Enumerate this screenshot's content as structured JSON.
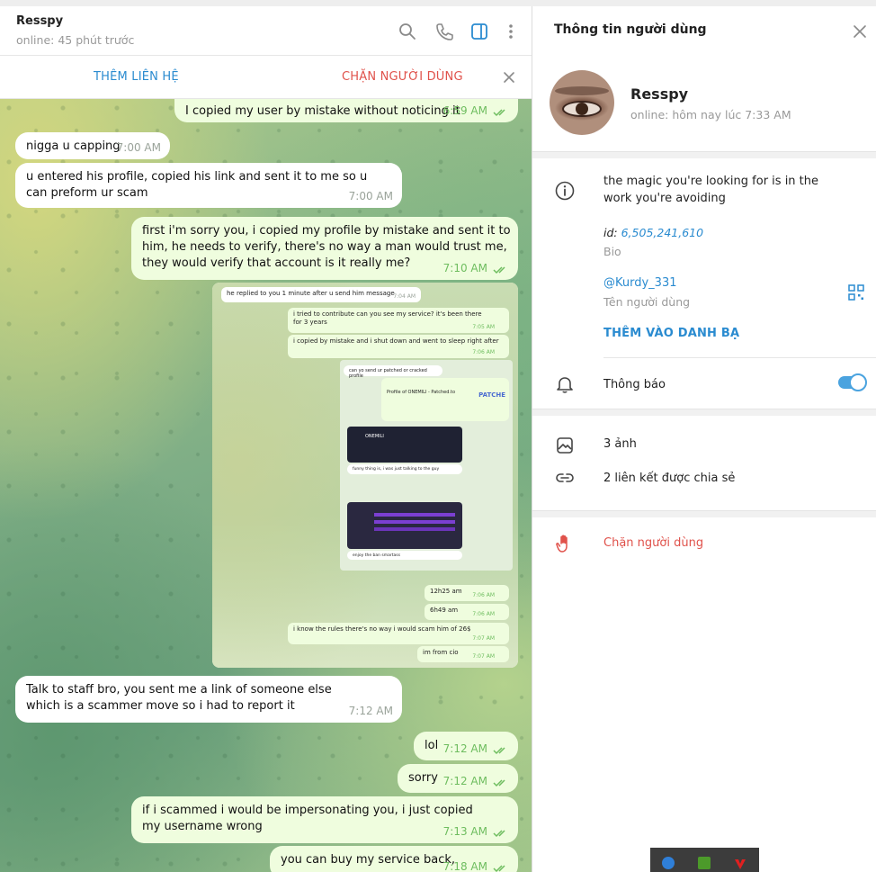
{
  "chat_header": {
    "name": "Resspy",
    "status": "online: 45 phút trước",
    "icons": [
      "search-icon",
      "phone-icon",
      "sidebar-toggle-icon",
      "more-vertical-icon"
    ]
  },
  "action_bar": {
    "add_contact": "THÊM LIÊN HỆ",
    "block_user": "CHẶN NGƯỜI DÙNG"
  },
  "messages": [
    {
      "dir": "out",
      "text": "I copied my user by mistake without noticing it",
      "time": "6:59 AM"
    },
    {
      "dir": "in",
      "text": "nigga u capping",
      "time": "7:00 AM"
    },
    {
      "dir": "in",
      "text": "u entered his profile, copied his link and sent it to me so u can preform ur scam",
      "time": "7:00 AM"
    },
    {
      "dir": "out",
      "text": "first i'm sorry you, i copied my profile by mistake and sent it to him, he needs to verify, there's no way a man would trust me, they would verify that account is it really me?",
      "time": "7:10 AM"
    },
    {
      "dir": "in",
      "text": "Talk to staff bro, you sent me a link of someone else which is a scammer move so i had to report it",
      "time": "7:12 AM"
    },
    {
      "dir": "out",
      "text": "lol",
      "time": "7:12 AM"
    },
    {
      "dir": "out",
      "text": "sorry",
      "time": "7:12 AM"
    },
    {
      "dir": "out",
      "text": "if i scammed i would be impersonating you, i just copied my username wrong",
      "time": "7:13 AM"
    },
    {
      "dir": "out",
      "text": "you can buy my service back,",
      "time": "7:18 AM"
    }
  ],
  "screenshot": {
    "m1": {
      "text": "he replied to you 1 minute after u send him message",
      "time": "7:04 AM"
    },
    "m2": {
      "text": "i tried to contribute can you see my service? it's been there for 3 years",
      "time": "7:05 AM"
    },
    "m3": {
      "text": "i copied by mistake and i shut down and went to sleep right after",
      "time": "7:06 AM"
    },
    "n1": "can yo send ur patched or cracked profile",
    "n2": "Profile of ONEMILI - Patched.to",
    "n3": "PATCHE",
    "n4": "ONEMILI",
    "n5": "funny thing is, i was just talking to the guy",
    "n6": "enjoy the ban smartass",
    "m4": {
      "text": "12h25 am",
      "time": "7:06 AM"
    },
    "m5": {
      "text": "6h49 am",
      "time": "7:06 AM"
    },
    "m6": {
      "text": "i know the rules there's no way i would scam him of 26$",
      "time": "7:07 AM"
    },
    "m7": {
      "text": "im from cio",
      "time": "7:07 AM"
    }
  },
  "info": {
    "title": "Thông tin người dùng",
    "name": "Resspy",
    "status": "online: hôm nay lúc 7:33 AM",
    "bio": "the magic you're looking for is in the work you're avoiding",
    "id_label": "id:",
    "id_value": "6,505,241,610",
    "bio_label": "Bio",
    "username": "@Kurdy_331",
    "username_label": "Tên người dùng",
    "add_to_contacts": "THÊM VÀO DANH BẠ",
    "notifications": "Thông báo",
    "notifications_on": true,
    "photos": "3 ảnh",
    "links": "2 liên kết được chia sẻ",
    "block": "Chặn người dùng"
  },
  "colors": {
    "accent": "#2a8bd0",
    "danger": "#e0524b",
    "outgoing_bubble": "#effdde",
    "read_ticks": "#6ebd5f"
  }
}
